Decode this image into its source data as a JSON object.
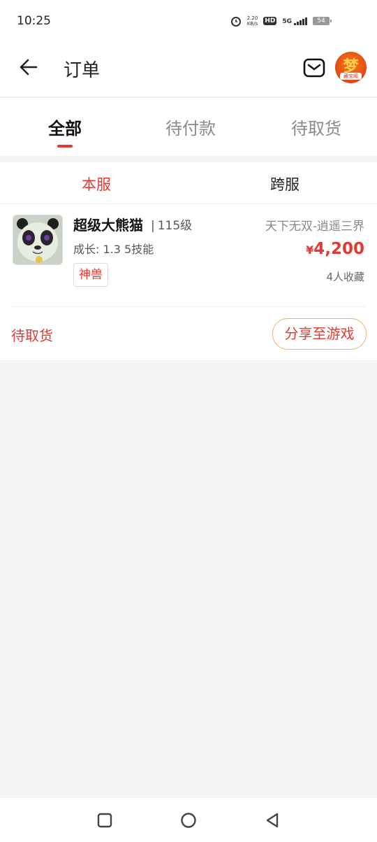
{
  "status_bar": {
    "time": "10:25",
    "net_speed_value": "2.20",
    "net_speed_unit": "KB/s",
    "hd_label": "HD",
    "network_label": "5G",
    "battery": "54"
  },
  "header": {
    "title": "订单",
    "avatar_glyph": "梦",
    "avatar_badge": "藏宝阁"
  },
  "tabs": [
    "全部",
    "待付款",
    "待取货"
  ],
  "active_tab": "全部",
  "subtabs": [
    "本服",
    "跨服"
  ],
  "order": {
    "name": "超级大熊猫",
    "separator": "|",
    "level": "115级",
    "server": "天下无双-逍遥三界",
    "growth": "成长: 1.3 5技能",
    "price_symbol": "¥",
    "price_value": "4,200",
    "tag": "神兽",
    "favorites": "4人收藏",
    "status": "待取货",
    "share_label": "分享至游戏"
  },
  "colors": {
    "accent": "#e23a32",
    "share_border": "#f0b070",
    "background": "#f4f4f4"
  }
}
